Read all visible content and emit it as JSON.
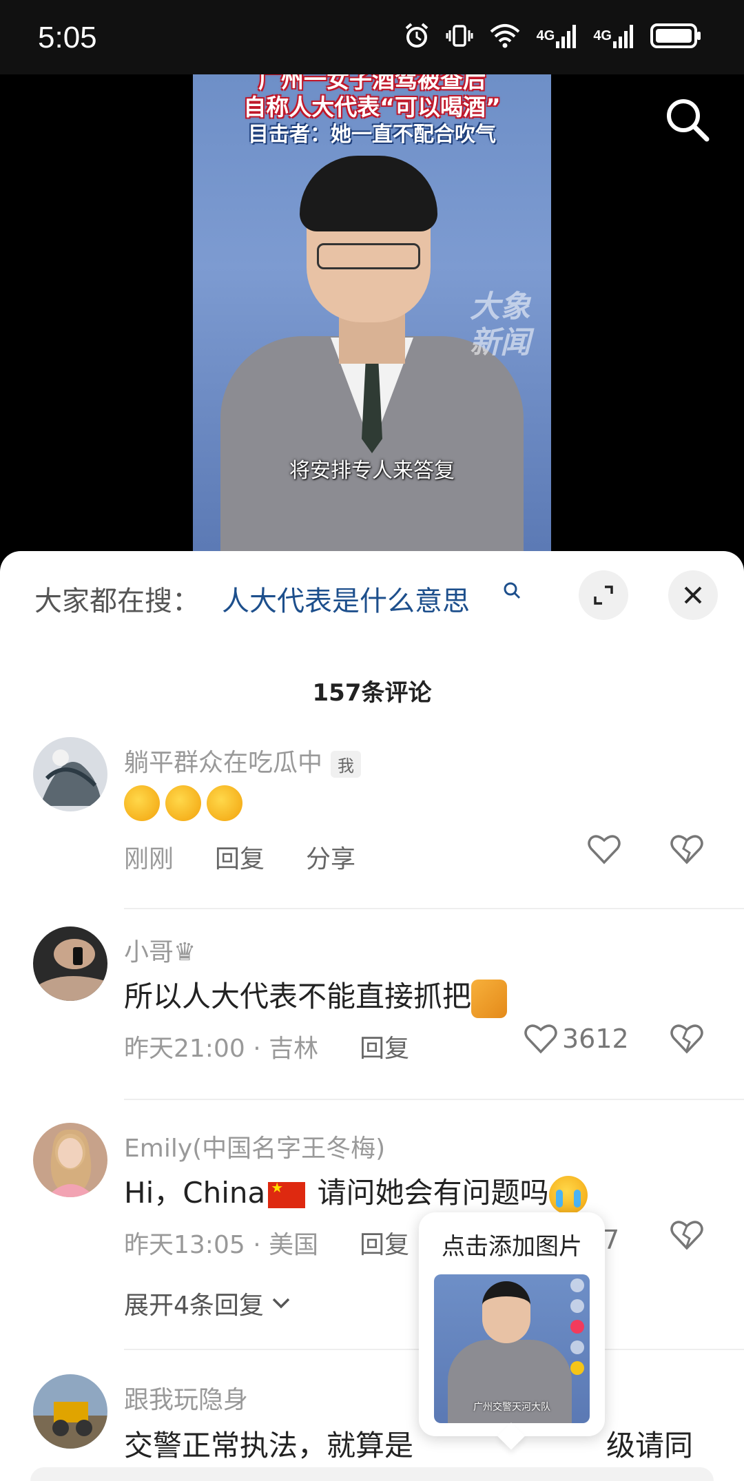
{
  "status_bar": {
    "time": "5:05",
    "icons": [
      "alarm-icon",
      "vibrate-icon",
      "wifi-icon",
      "signal-4g-icon",
      "signal-4g-icon",
      "battery-icon"
    ],
    "net_label_1": "4G",
    "net_label_2": "4G"
  },
  "video": {
    "headline_line1": "广州一女子酒驾被查后",
    "headline_line2": "自称人大代表“可以喝酒”",
    "headline_line3": "目击者：她一直不配合吹气",
    "watermark": "大象\n新闻",
    "subtitle": "将安排专人来答复"
  },
  "search": {
    "prefix": "大家都在搜：",
    "query": "人大代表是什么意思"
  },
  "comments_header": {
    "count_label": "157条评论"
  },
  "comments": [
    {
      "username": "躺平群众在吃瓜中",
      "badge": "我",
      "content": "",
      "time": "刚刚",
      "reply": "回复",
      "share": "分享",
      "likes": ""
    },
    {
      "username": "小哥♛",
      "content": "所以人大代表不能直接抓把",
      "time": "昨天21:00 · 吉林",
      "reply": "回复",
      "likes": "3612"
    },
    {
      "username": "Emily(中国名字王冬梅)",
      "content_pre": "Hi，China",
      "content_post": " 请问她会有问题吗",
      "time": "昨天13:05 · 美国",
      "reply": "回复",
      "likes_partial": "7",
      "expand": "展开4条回复"
    },
    {
      "username": "跟我玩隐身",
      "content_left": "交警正常执法，就算是",
      "content_right": "级请同"
    }
  ],
  "popup": {
    "title": "点击添加图片",
    "thumb_caption": "广州交警天河大队"
  }
}
